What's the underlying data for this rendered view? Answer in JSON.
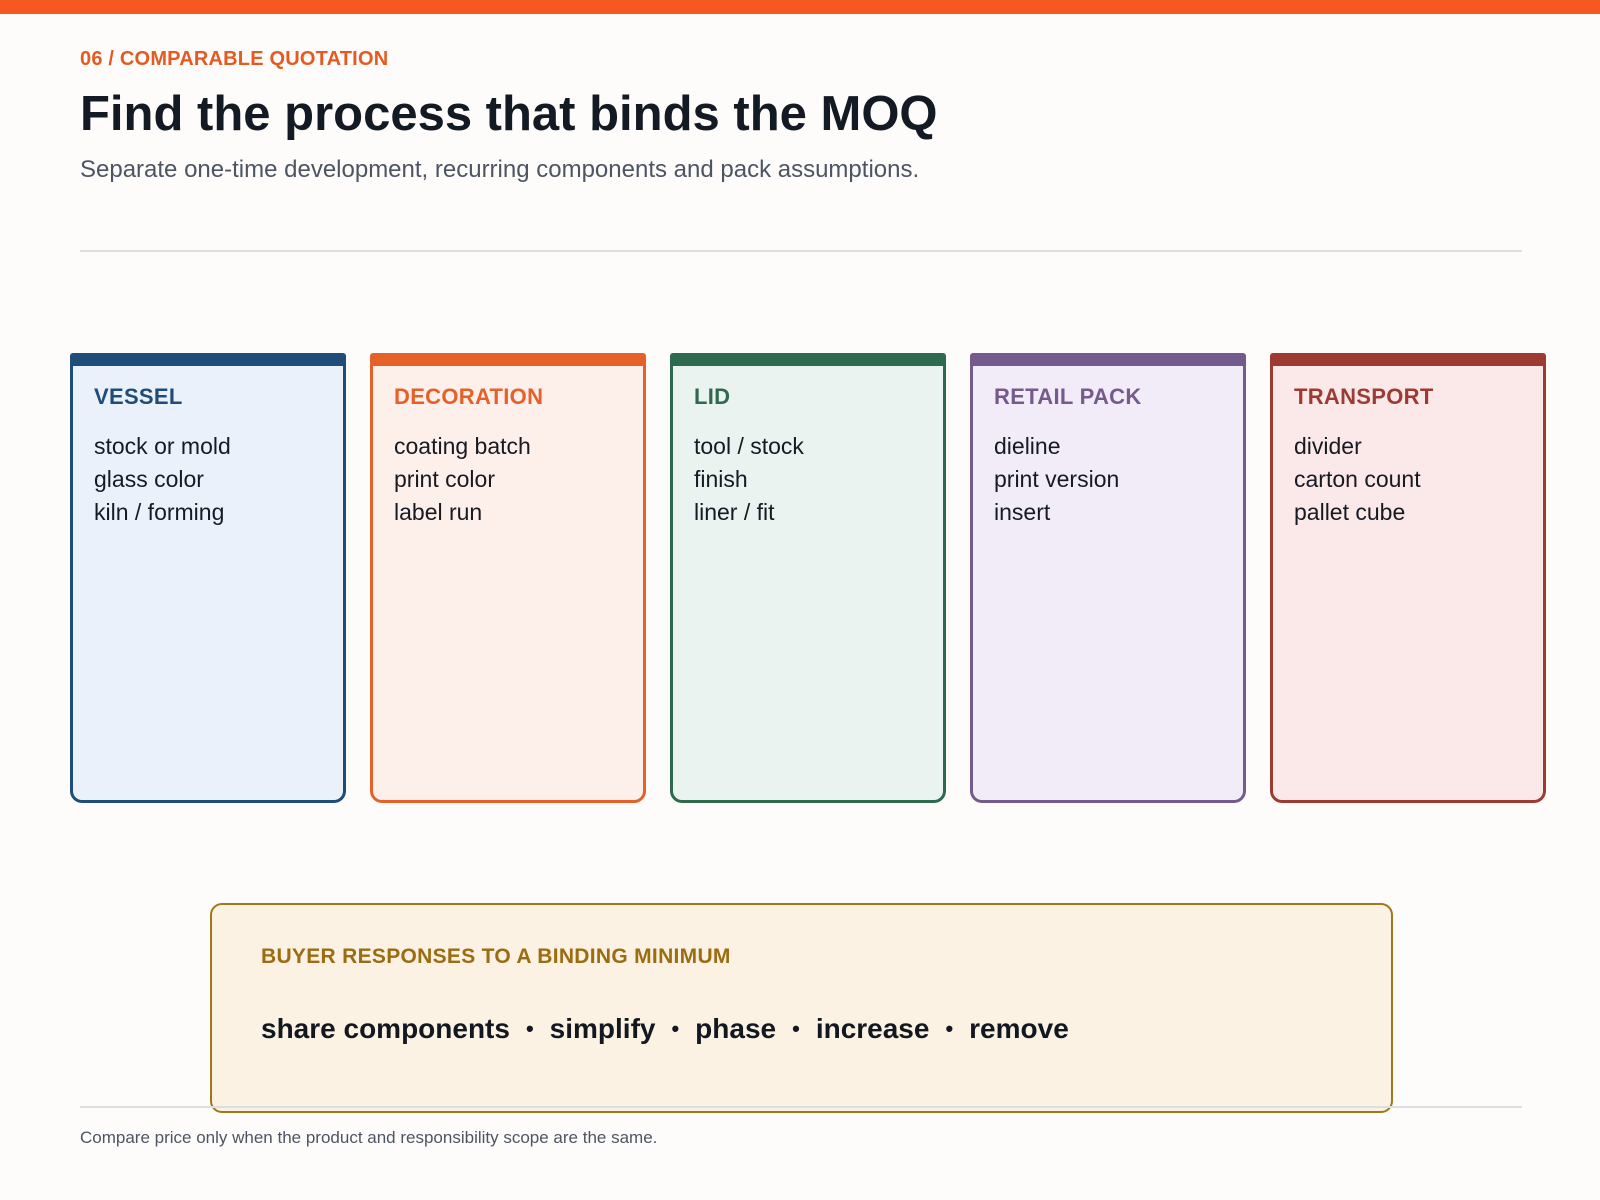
{
  "header": {
    "kicker": "06 / COMPARABLE QUOTATION",
    "title": "Find the process that binds the MOQ",
    "subtitle": "Separate one-time development, recurring components and pack assumptions."
  },
  "cards": [
    {
      "title": "VESSEL",
      "color": "#1f4c78",
      "background": "#ebf1fb",
      "items": [
        "stock or mold",
        "glass color",
        "kiln / forming"
      ]
    },
    {
      "title": "DECORATION",
      "color": "#e6612a",
      "background": "#fdefea",
      "items": [
        "coating batch",
        "print color",
        "label run"
      ]
    },
    {
      "title": "LID",
      "color": "#2f6a4e",
      "background": "#eaf3ef",
      "items": [
        "tool / stock",
        "finish",
        "liner / fit"
      ]
    },
    {
      "title": "RETAIL PACK",
      "color": "#755a8c",
      "background": "#f2ecf9",
      "items": [
        "dieline",
        "print version",
        "insert"
      ]
    },
    {
      "title": "TRANSPORT",
      "color": "#9d3b33",
      "background": "#fbe9ea",
      "items": [
        "divider",
        "carton count",
        "pallet cube"
      ]
    }
  ],
  "callout": {
    "title": "BUYER RESPONSES TO A BINDING MINIMUM",
    "separator": "•",
    "options": [
      "share components",
      "simplify",
      "phase",
      "increase",
      "remove"
    ]
  },
  "footer": {
    "note": "Compare price only when the product and responsibility scope are the same."
  },
  "colors": {
    "accent": "#f75820",
    "callout_border": "#a0771a",
    "callout_title": "#9b6c12"
  }
}
